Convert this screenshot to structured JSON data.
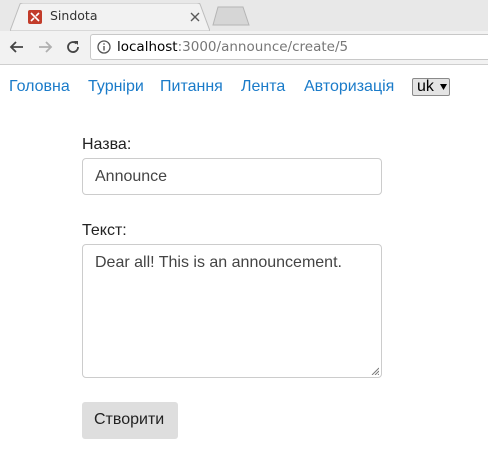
{
  "browser": {
    "tab_title": "Sindota",
    "url": {
      "host": "localhost",
      "path": ":3000/announce/create/5"
    },
    "favicon": "dota-logo-icon"
  },
  "navbar": {
    "links": [
      {
        "label": "Головна"
      },
      {
        "label": "Турніри"
      },
      {
        "label": "Питання"
      },
      {
        "label": "Лента"
      },
      {
        "label": "Авторизація"
      }
    ],
    "language": {
      "selected": "uk"
    }
  },
  "form": {
    "title_label": "Назва:",
    "title_value": "Announce",
    "text_label": "Текст:",
    "text_value": "Dear all! This is an announcement.",
    "submit_label": "Створити"
  },
  "colors": {
    "link": "#1a7bc9",
    "button_bg": "#dedede",
    "favicon": "#c23c2a"
  }
}
